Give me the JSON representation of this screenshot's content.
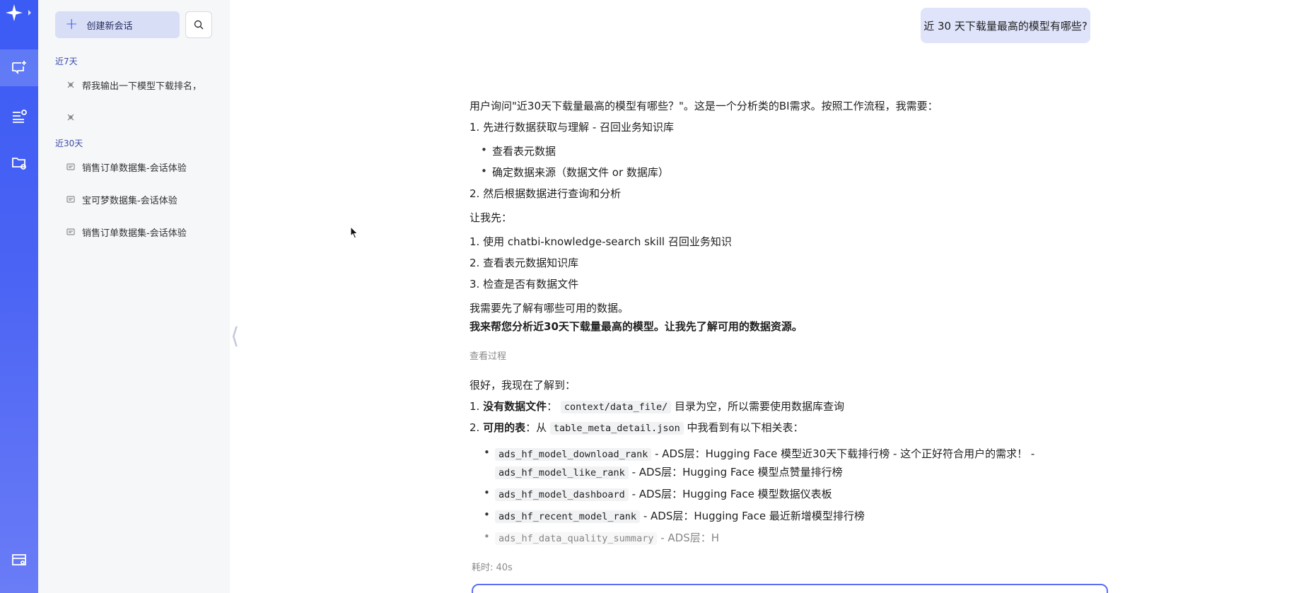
{
  "sidebar": {
    "new_chat_label": "创建新会话",
    "groups": [
      {
        "label": "近7天",
        "items": [
          {
            "label": "帮我输出一下模型下载排名，"
          },
          {
            "label": ""
          }
        ]
      },
      {
        "label": "近30天",
        "items": [
          {
            "label": "销售订单数据集-会话体验"
          },
          {
            "label": "宝可梦数据集-会话体验"
          },
          {
            "label": "销售订单数据集-会话体验"
          }
        ]
      }
    ]
  },
  "chat": {
    "user_message": "近 30 天下载量最高的模型有哪些?",
    "thinking": {
      "intro": "用户询问\"近30天下载量最高的模型有哪些？\"。这是一个分析类的BI需求。按照工作流程，我需要：",
      "step1": "1. 先进行数据获取与理解 - 召回业务知识库",
      "step1_bullets": [
        "查看表元数据",
        "确定数据来源（数据文件 or 数据库）"
      ],
      "step2": "2. 然后根据数据进行查询和分析",
      "let_me": "让我先：",
      "todo": [
        "1. 使用 chatbi-knowledge-search skill 召回业务知识",
        "2. 查看表元数据知识库",
        "3. 检查是否有数据文件"
      ],
      "need": "我需要先了解有哪些可用的数据。"
    },
    "answer_lead": "我来帮您分析近30天下载量最高的模型。让我先了解可用的数据资源。",
    "view_process": "查看过程",
    "findings_intro": "很好，我现在了解到：",
    "finding1": {
      "num": "1.",
      "bold": "没有数据文件",
      "sep": "：",
      "code": "context/data_file/",
      "text": "目录为空，所以需要使用数据库查询"
    },
    "finding2": {
      "num": "2.",
      "bold": "可用的表",
      "sep": "：从",
      "code": "table_meta_detail.json",
      "text": "中我看到有以下相关表："
    },
    "tables": [
      {
        "code": "ads_hf_model_download_rank",
        "desc": "- ADS层：Hugging Face 模型近30天下载排行榜 - 这个正好符合用户的需求！ -"
      },
      {
        "code": "ads_hf_model_like_rank",
        "desc": "- ADS层：Hugging Face 模型点赞量排行榜"
      },
      {
        "code": "ads_hf_model_dashboard",
        "desc": "- ADS层：Hugging Face 模型数据仪表板"
      },
      {
        "code": "ads_hf_recent_model_rank",
        "desc": "- ADS层：Hugging Face 最近新增模型排行榜"
      },
      {
        "code": "ads_hf_data_quality_summary",
        "desc": "- ADS层：H"
      }
    ],
    "elapsed": "耗时: 40s"
  }
}
